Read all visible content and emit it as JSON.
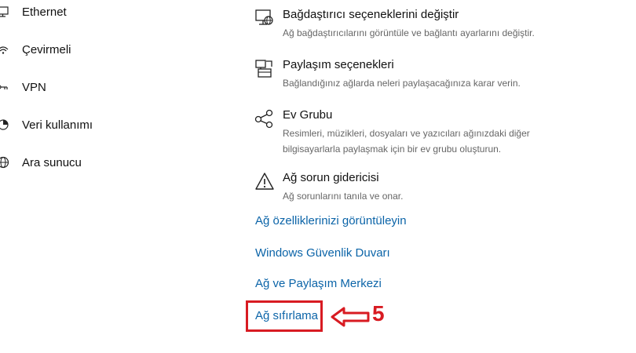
{
  "sidebar": {
    "items": [
      {
        "label": "Ethernet",
        "icon": "monitor-icon"
      },
      {
        "label": "Çevirmeli",
        "icon": "dialup-icon"
      },
      {
        "label": "VPN",
        "icon": "vpn-icon"
      },
      {
        "label": "Veri kullanımı",
        "icon": "data-usage-icon"
      },
      {
        "label": "Ara sunucu",
        "icon": "globe-icon"
      }
    ]
  },
  "options": [
    {
      "title": "Bağdaştırıcı seçeneklerini değiştir",
      "description": "Ağ bağdaştırıcılarını görüntüle ve bağlantı ayarlarını değiştir.",
      "icon": "adapter-icon"
    },
    {
      "title": "Paylaşım seçenekleri",
      "description": "Bağlandığınız ağlarda neleri paylaşacağınıza karar verin.",
      "icon": "sharing-icon"
    },
    {
      "title": "Ev Grubu",
      "description": "Resimleri, müzikleri, dosyaları ve yazıcıları ağınızdaki diğer bilgisayarlarla paylaşmak için bir ev grubu oluşturun.",
      "icon": "homegroup-icon"
    },
    {
      "title": "Ağ sorun gidericisi",
      "description": "Ağ sorunlarını tanıla ve onar.",
      "icon": "warning-icon"
    }
  ],
  "links": [
    {
      "label": "Ağ özelliklerinizi görüntüleyin"
    },
    {
      "label": "Windows Güvenlik Duvarı"
    },
    {
      "label": "Ağ ve Paylaşım Merkezi"
    },
    {
      "label": "Ağ sıfırlama"
    }
  ],
  "annotation": {
    "number": "5",
    "color": "#d81b22"
  },
  "colors": {
    "link": "#0b64a8",
    "description": "#666666",
    "annotation": "#d81b22"
  }
}
